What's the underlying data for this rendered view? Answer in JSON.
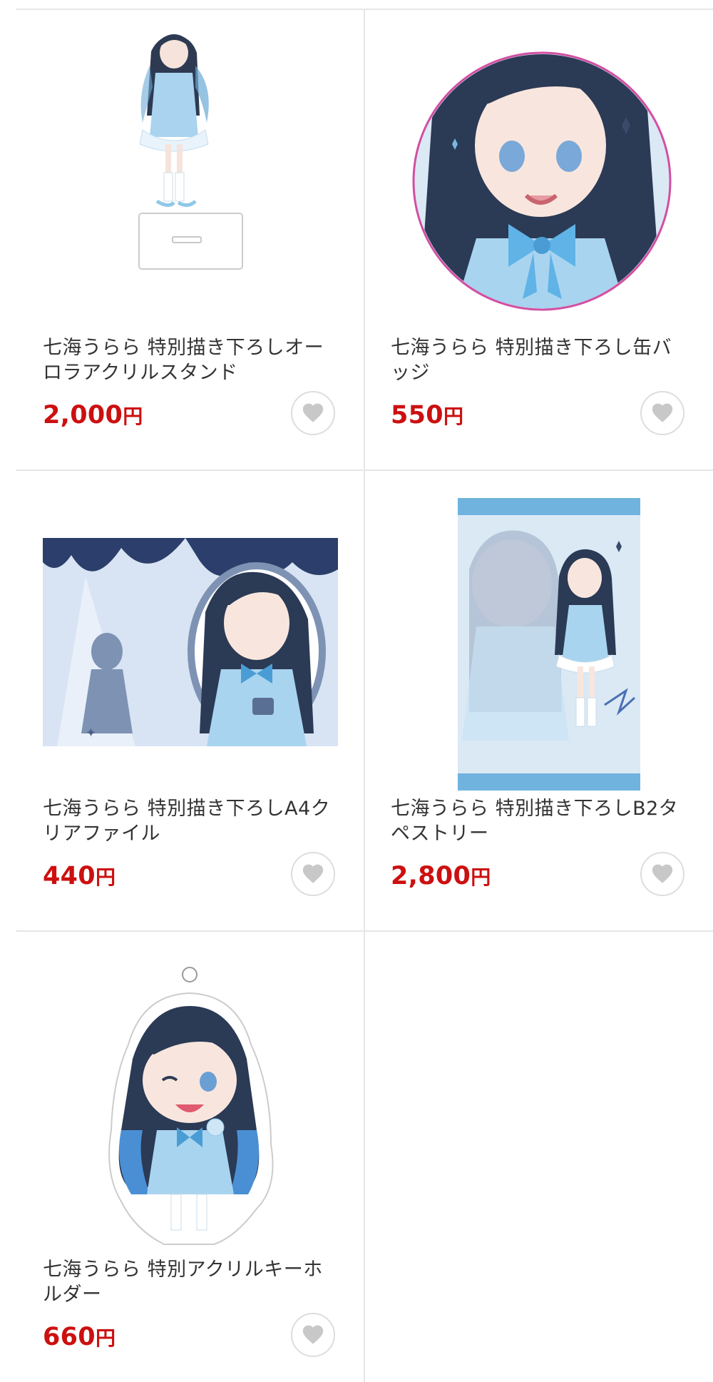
{
  "products": [
    {
      "title": "七海うらら 特別描き下ろしオーロラアクリルスタンド",
      "price": "2,000",
      "currency": "円",
      "image_alt": "acrylic-stand-image"
    },
    {
      "title": "七海うらら 特別描き下ろし缶バッジ",
      "price": "550",
      "currency": "円",
      "image_alt": "can-badge-image"
    },
    {
      "title": "七海うらら 特別描き下ろしA4クリアファイル",
      "price": "440",
      "currency": "円",
      "image_alt": "clear-file-image"
    },
    {
      "title": "七海うらら 特別描き下ろしB2タペストリー",
      "price": "2,800",
      "currency": "円",
      "image_alt": "tapestry-image"
    },
    {
      "title": "七海うらら 特別アクリルキーホルダー",
      "price": "660",
      "currency": "円",
      "image_alt": "keychain-image"
    }
  ],
  "colors": {
    "price": "#cc1010",
    "divider": "#e6e6e6",
    "heart": "#c8c8c8",
    "accent_blue": "#8fc8e8"
  },
  "icons": {
    "favorite": "heart-icon"
  }
}
